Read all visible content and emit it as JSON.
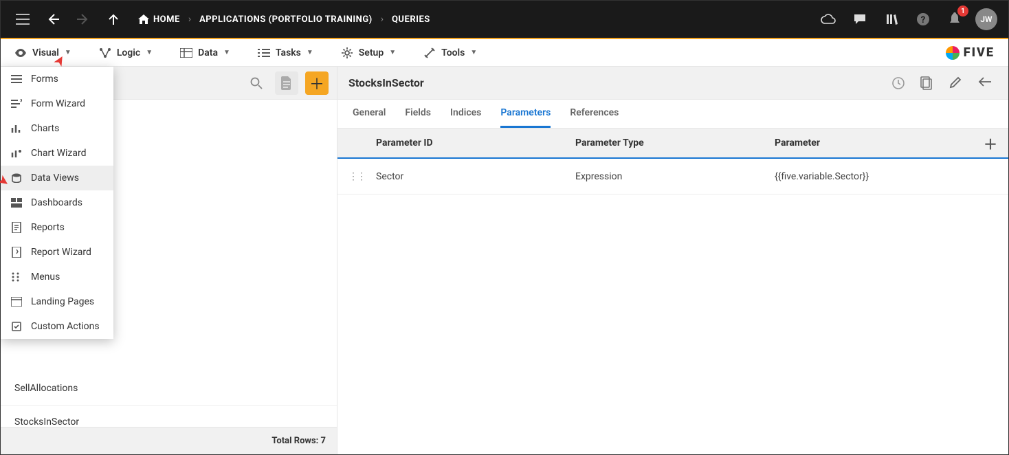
{
  "topbar": {
    "breadcrumb": {
      "home": "HOME",
      "applications": "APPLICATIONS (PORTFOLIO TRAINING)",
      "queries": "QUERIES"
    },
    "badge_count": "1",
    "avatar_initials": "JW"
  },
  "toolbar": {
    "visual": "Visual",
    "logic": "Logic",
    "data": "Data",
    "tasks": "Tasks",
    "setup": "Setup",
    "tools": "Tools",
    "brand": "FIVE"
  },
  "visual_menu": {
    "items": [
      "Forms",
      "Form Wizard",
      "Charts",
      "Chart Wizard",
      "Data Views",
      "Dashboards",
      "Reports",
      "Report Wizard",
      "Menus",
      "Landing Pages",
      "Custom Actions"
    ]
  },
  "left": {
    "rows": [
      "SellAllocations",
      "StocksInSector"
    ],
    "total_label": "Total Rows: 7"
  },
  "right": {
    "title": "StocksInSector",
    "tabs": [
      "General",
      "Fields",
      "Indices",
      "Parameters",
      "References"
    ],
    "active_tab": "Parameters",
    "columns": {
      "id": "Parameter ID",
      "type": "Parameter Type",
      "value": "Parameter"
    },
    "rows": [
      {
        "id": "Sector",
        "type": "Expression",
        "value": "{{five.variable.Sector}}"
      }
    ]
  }
}
